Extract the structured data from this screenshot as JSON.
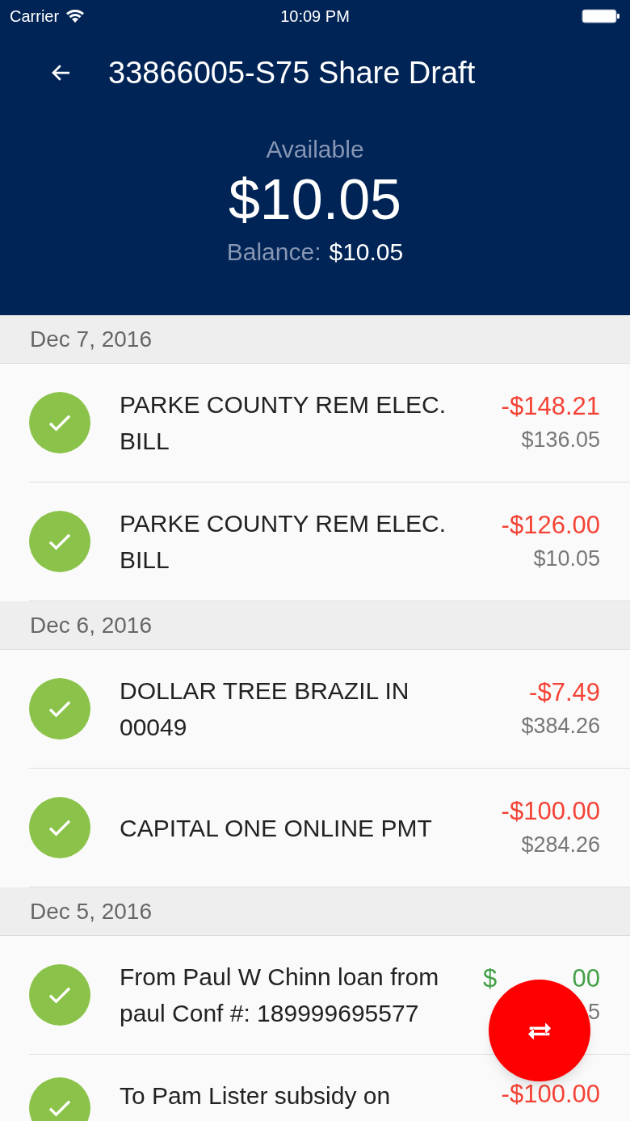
{
  "status_bar": {
    "carrier": "Carrier",
    "time": "10:09 PM"
  },
  "header": {
    "title": "33866005-S75 Share Draft",
    "available_label": "Available",
    "available": "$10.05",
    "balance_label": "Balance:",
    "balance": "$10.05"
  },
  "sections": [
    {
      "date": "Dec 7, 2016",
      "transactions": [
        {
          "description": "PARKE COUNTY REM ELEC. BILL",
          "amount": "-$148.21",
          "color": "#f44336",
          "balance": "$136.05",
          "cleared": true
        },
        {
          "description": "PARKE COUNTY REM ELEC. BILL",
          "amount": "-$126.00",
          "color": "#f44336",
          "balance": "$10.05",
          "cleared": true
        }
      ]
    },
    {
      "date": "Dec 6, 2016",
      "transactions": [
        {
          "description": "DOLLAR TREE  BRAZIL IN 00049",
          "amount": "-$7.49",
          "color": "#f44336",
          "balance": "$384.26",
          "cleared": true
        },
        {
          "description": "CAPITAL ONE ONLINE PMT",
          "amount": "-$100.00",
          "color": "#f44336",
          "balance": "$284.26",
          "cleared": true
        }
      ]
    },
    {
      "date": "Dec 5, 2016",
      "transactions": [
        {
          "description": "From Paul W Chinn loan from paul Conf #: 189999695577",
          "amount": "$",
          "amount_end": "00",
          "color": "#43a047",
          "balance_end": "5",
          "cleared": true
        },
        {
          "description": "To Pam Lister subsidy on",
          "amount": "-$100.00",
          "color": "#f44336",
          "cleared": true
        }
      ]
    }
  ]
}
